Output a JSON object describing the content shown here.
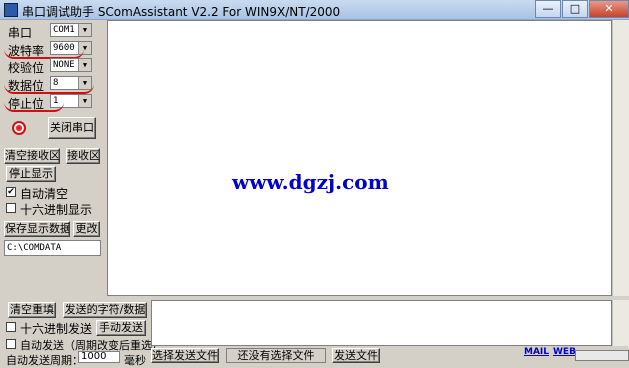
{
  "window": {
    "title": "串口调试助手 SComAssistant V2.2 For WIN9X/NT/2000",
    "minimize": "—",
    "maximize": "□",
    "close": "✕"
  },
  "settings": {
    "port_label": "串口",
    "port_value": "COM1",
    "baud_label": "波特率",
    "baud_value": "9600",
    "parity_label": "校验位",
    "parity_value": "NONE",
    "databits_label": "数据位",
    "databits_value": "8",
    "stopbits_label": "停止位",
    "stopbits_value": "1"
  },
  "controls": {
    "close_port": "关闭串口",
    "clear_rx": "清空接收区",
    "rx_area": "接收区",
    "stop_display": "停止显示",
    "auto_clear": "自动清空",
    "hex_display": "十六进制显示",
    "save_data": "保存显示数据",
    "change": "更改",
    "save_path": "C:\\COMDATA"
  },
  "receive": {
    "text": "www.dgzj.com"
  },
  "send": {
    "clear_resend": "清空重填",
    "send_area_label": "发送的字符/数据",
    "hex_send": "十六进制发送",
    "manual_send": "手动发送",
    "auto_send": "自动发送（周期改变后重选）",
    "period_label": "自动发送周期：",
    "period_value": "1000",
    "ms": "毫秒",
    "select_file": "选择发送文件",
    "no_file": "还没有选择文件",
    "send_file": "发送文件",
    "mail": "MAIL",
    "web": "WEB"
  },
  "colors": {
    "accent_red": "#d01010",
    "url_blue": "#0000cc"
  },
  "icons": {
    "indicator": "red-indicator-icon"
  }
}
